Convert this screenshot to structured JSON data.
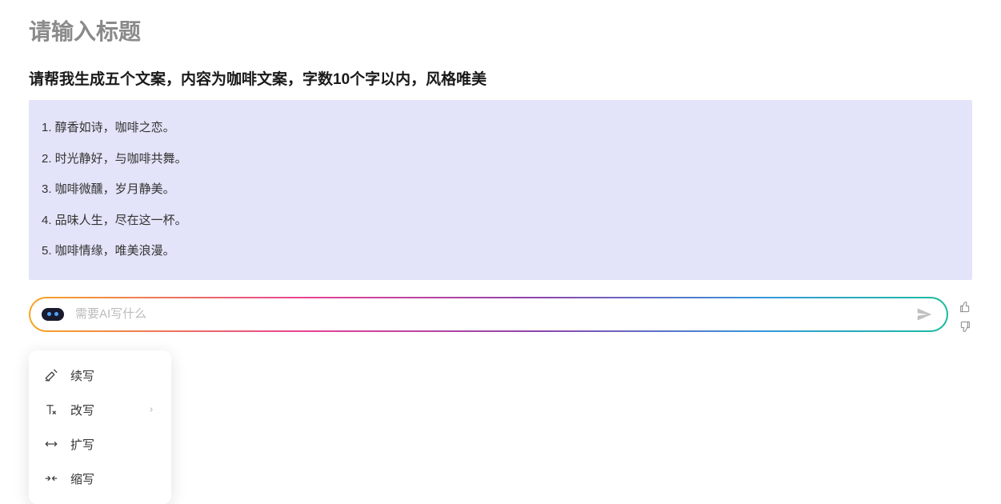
{
  "title_placeholder": "请输入标题",
  "prompt": "请帮我生成五个文案，内容为咖啡文案，字数10个字以内，风格唯美",
  "responses": [
    "1. 醇香如诗，咖啡之恋。",
    "2. 时光静好，与咖啡共舞。",
    "3. 咖啡微醺，岁月静美。",
    "4. 品味人生，尽在这一杯。",
    "5. 咖啡情缘，唯美浪漫。"
  ],
  "input_placeholder": "需要AI写什么",
  "menu": {
    "items": [
      {
        "label": "续写",
        "has_submenu": false
      },
      {
        "label": "改写",
        "has_submenu": true
      },
      {
        "label": "扩写",
        "has_submenu": false
      },
      {
        "label": "缩写",
        "has_submenu": false
      }
    ]
  }
}
